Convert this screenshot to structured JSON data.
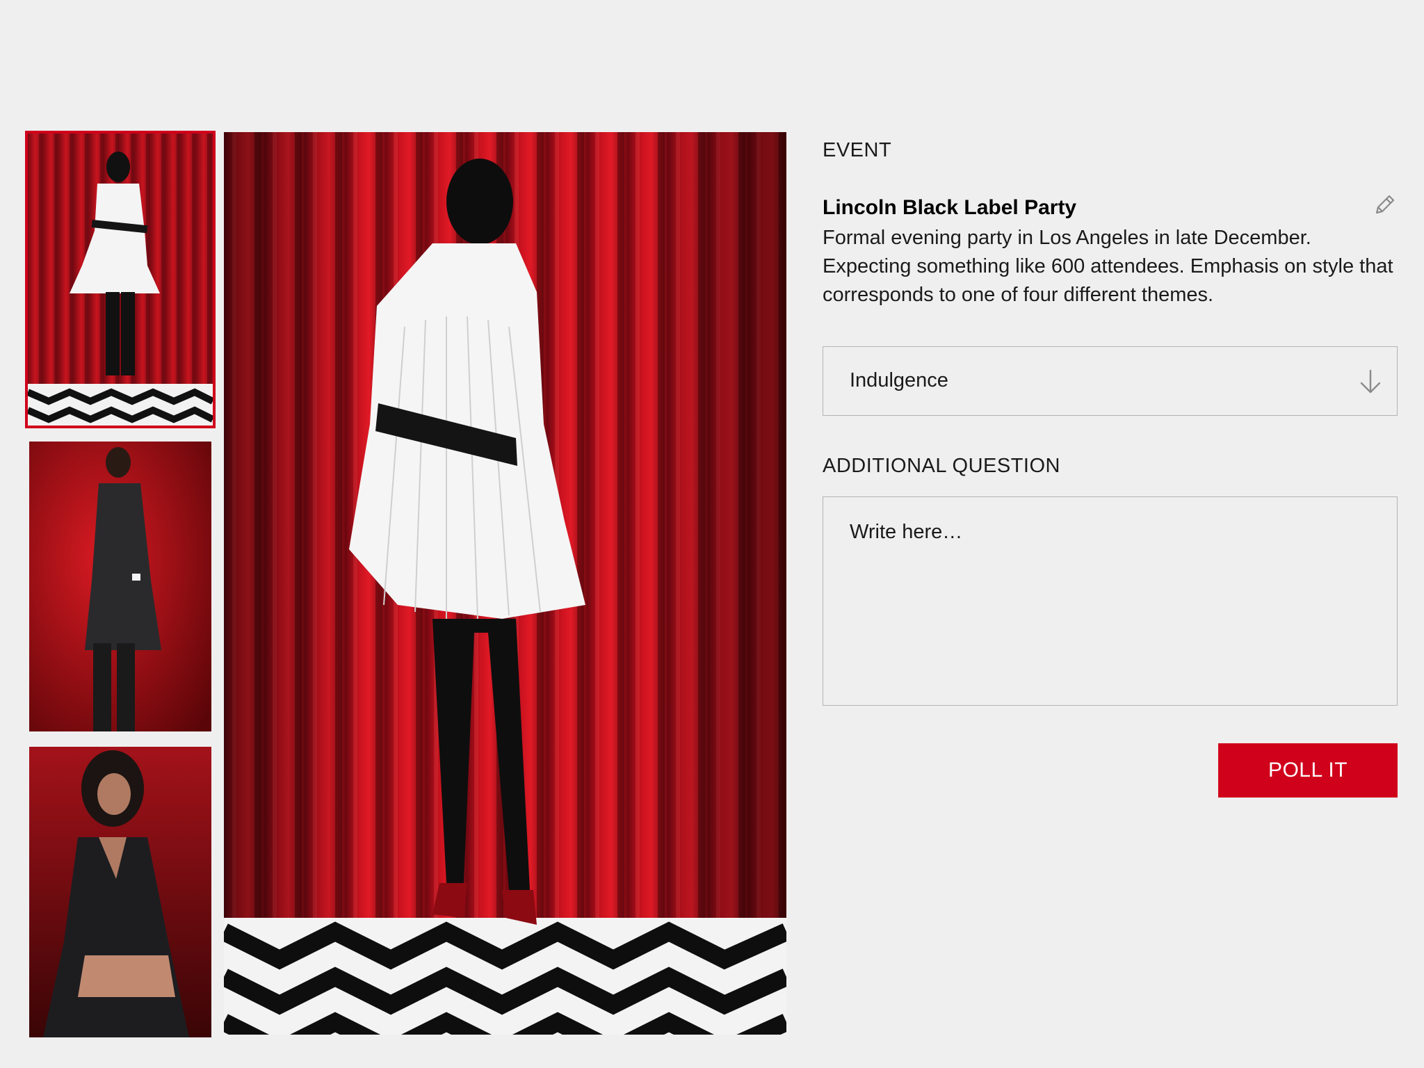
{
  "gallery": {
    "thumbnails": [
      {
        "name": "look-white-pleated-back",
        "selected": true
      },
      {
        "name": "look-black-pleated-coat",
        "selected": false
      },
      {
        "name": "look-black-sequin-dress",
        "selected": false
      }
    ],
    "main_image": "look-white-pleated-back",
    "colors": {
      "curtain": "#b5101c",
      "selection": "#d0021b"
    }
  },
  "event": {
    "section_label": "EVENT",
    "title": "Lincoln Black Label Party",
    "description": "Formal evening party in Los Angeles in late December. Expecting something like 600 attendees. Emphasis on style that corresponds to one of four different themes.",
    "edit_icon": "pencil-icon"
  },
  "theme_select": {
    "value": "Indulgence",
    "icon": "arrow-down-icon"
  },
  "question": {
    "section_label": "ADDITIONAL QUESTION",
    "placeholder": "Write here…",
    "value": ""
  },
  "actions": {
    "poll_label": "POLL IT",
    "accent_color": "#d0021b"
  }
}
